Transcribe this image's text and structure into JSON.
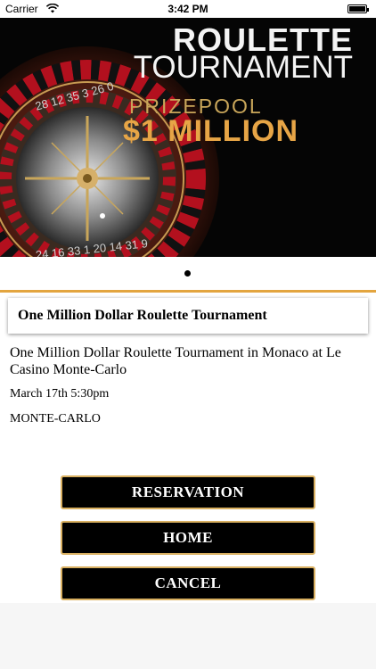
{
  "status_bar": {
    "carrier": "Carrier",
    "time": "3:42 PM",
    "wifi_icon": "wifi-icon",
    "battery_icon": "battery-icon"
  },
  "banner": {
    "title_line1": "ROULETTE",
    "title_line2": "TOURNAMENT",
    "prize_label": "PRIZEPOOL",
    "prize_amount": "$1 MILLION",
    "wheel_numbers": "28 12 35 3 26 0",
    "wheel_numbers_bottom": "24 16 33 1 20 14 31 9",
    "colors": {
      "accent_gold": "#e7a546",
      "wheel_red": "#b3101e"
    }
  },
  "event": {
    "title": "One Million Dollar Roulette Tournament",
    "description": "One Million Dollar Roulette Tournament in Monaco at Le Casino Monte-Carlo",
    "date": "March 17th 5:30pm",
    "location": "MONTE-CARLO"
  },
  "buttons": {
    "reservation": "RESERVATION",
    "home": "HOME",
    "cancel": "CANCEL"
  },
  "theme": {
    "divider_color": "#e3a53f",
    "button_border": "#d9b061"
  }
}
